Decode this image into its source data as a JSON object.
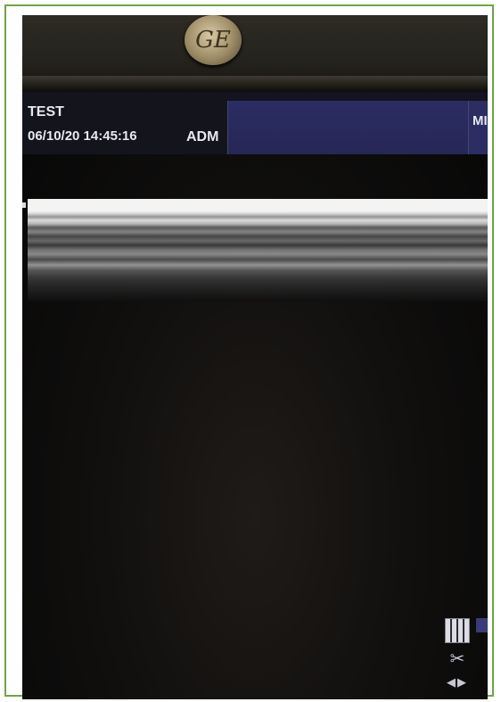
{
  "bezel": {
    "brand_logo": "GE"
  },
  "header": {
    "patient_name": "TEST",
    "datetime": "06/10/20 14:45:16",
    "operator": "ADM",
    "right_label": "MI"
  },
  "icons": [
    "keypad-icon",
    "scalpel-icon",
    "arrows-icon",
    "cursor-icon"
  ],
  "colors": {
    "frame_border": "#6ea544",
    "header_panel": "#2b2d63"
  }
}
